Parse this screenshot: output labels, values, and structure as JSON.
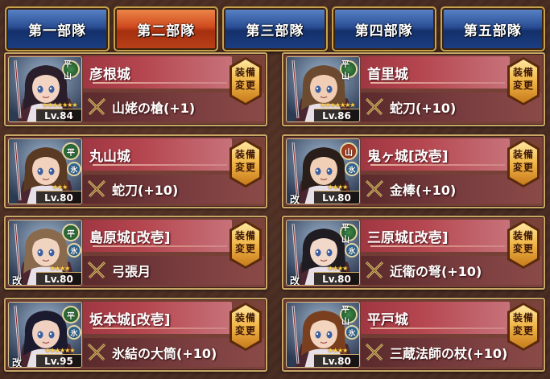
{
  "tabs": [
    {
      "label": "第一部隊",
      "active": false
    },
    {
      "label": "第二部隊",
      "active": true
    },
    {
      "label": "第三部隊",
      "active": false
    },
    {
      "label": "第四部隊",
      "active": false
    },
    {
      "label": "第五部隊",
      "active": false
    }
  ],
  "equip_button_label": [
    "装備",
    "変更"
  ],
  "cards": [
    {
      "name": "彦根城",
      "weapon": "山姥の槍(+1)",
      "level": "Lv.84",
      "stars": "★★★★★★★",
      "terrain": "平山",
      "attribute": "",
      "kai": "",
      "hair": "#2a1e2a",
      "skin": "#f3d3c2"
    },
    {
      "name": "首里城",
      "weapon": "蛇刀(+10)",
      "level": "Lv.86",
      "stars": "★★★★★★★",
      "terrain": "平山",
      "attribute": "",
      "kai": "",
      "hair": "#6b4a2f",
      "skin": "#f0cdb4"
    },
    {
      "name": "丸山城",
      "weapon": "蛇刀(+10)",
      "level": "Lv.80",
      "stars": "★★★",
      "terrain": "平",
      "attribute": "氷",
      "kai": "",
      "hair": "#5a3a22",
      "skin": "#f2d2bc"
    },
    {
      "name": "鬼ヶ城[改壱]",
      "weapon": "金棒(+10)",
      "level": "Lv.80",
      "stars": "★★★★",
      "terrain": "山",
      "attribute": "氷",
      "kai": "改",
      "hair": "#2a1e1a",
      "skin": "#f1cfb6"
    },
    {
      "name": "島原城[改壱]",
      "weapon": "弓張月",
      "level": "Lv.80",
      "stars": "★★★★",
      "terrain": "平",
      "attribute": "氷",
      "kai": "改",
      "hair": "#8a6a4c",
      "skin": "#f1d4c0"
    },
    {
      "name": "三原城[改壱]",
      "weapon": "近衛の弩(+10)",
      "level": "Lv.80",
      "stars": "★★★★",
      "terrain": "平山",
      "attribute": "氷",
      "kai": "改",
      "hair": "#1f1c22",
      "skin": "#f2d8c8"
    },
    {
      "name": "坂本城[改壱]",
      "weapon": "氷結の大筒(+10)",
      "level": "Lv.95",
      "stars": "★★★★★★",
      "terrain": "平",
      "attribute": "氷",
      "kai": "改",
      "hair": "#1b1a2e",
      "skin": "#f0d0c0"
    },
    {
      "name": "平戸城",
      "weapon": "三蔵法師の杖(+10)",
      "level": "Lv.80",
      "stars": "★★★★",
      "terrain": "平山",
      "attribute": "氷",
      "kai": "",
      "hair": "#7a3f1e",
      "skin": "#f3d4bf"
    }
  ],
  "colors": {
    "tab_blue": "#2a4d93",
    "tab_red": "#cf4a1f",
    "name_band": "#b5464f",
    "frame_gold": "#c9a766"
  }
}
